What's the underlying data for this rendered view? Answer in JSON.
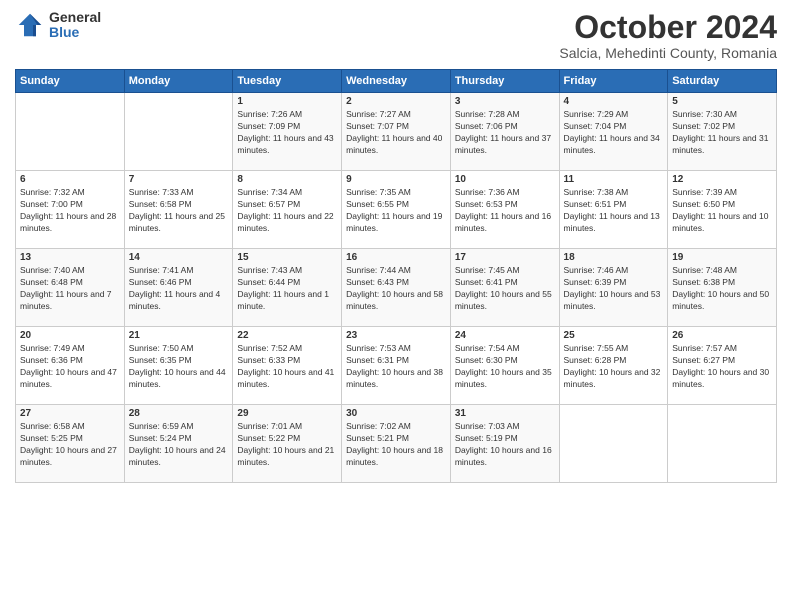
{
  "logo": {
    "general": "General",
    "blue": "Blue"
  },
  "header": {
    "month": "October 2024",
    "location": "Salcia, Mehedinti County, Romania"
  },
  "days_of_week": [
    "Sunday",
    "Monday",
    "Tuesday",
    "Wednesday",
    "Thursday",
    "Friday",
    "Saturday"
  ],
  "weeks": [
    [
      {
        "day": "",
        "info": ""
      },
      {
        "day": "",
        "info": ""
      },
      {
        "day": "1",
        "info": "Sunrise: 7:26 AM\nSunset: 7:09 PM\nDaylight: 11 hours and 43 minutes."
      },
      {
        "day": "2",
        "info": "Sunrise: 7:27 AM\nSunset: 7:07 PM\nDaylight: 11 hours and 40 minutes."
      },
      {
        "day": "3",
        "info": "Sunrise: 7:28 AM\nSunset: 7:06 PM\nDaylight: 11 hours and 37 minutes."
      },
      {
        "day": "4",
        "info": "Sunrise: 7:29 AM\nSunset: 7:04 PM\nDaylight: 11 hours and 34 minutes."
      },
      {
        "day": "5",
        "info": "Sunrise: 7:30 AM\nSunset: 7:02 PM\nDaylight: 11 hours and 31 minutes."
      }
    ],
    [
      {
        "day": "6",
        "info": "Sunrise: 7:32 AM\nSunset: 7:00 PM\nDaylight: 11 hours and 28 minutes."
      },
      {
        "day": "7",
        "info": "Sunrise: 7:33 AM\nSunset: 6:58 PM\nDaylight: 11 hours and 25 minutes."
      },
      {
        "day": "8",
        "info": "Sunrise: 7:34 AM\nSunset: 6:57 PM\nDaylight: 11 hours and 22 minutes."
      },
      {
        "day": "9",
        "info": "Sunrise: 7:35 AM\nSunset: 6:55 PM\nDaylight: 11 hours and 19 minutes."
      },
      {
        "day": "10",
        "info": "Sunrise: 7:36 AM\nSunset: 6:53 PM\nDaylight: 11 hours and 16 minutes."
      },
      {
        "day": "11",
        "info": "Sunrise: 7:38 AM\nSunset: 6:51 PM\nDaylight: 11 hours and 13 minutes."
      },
      {
        "day": "12",
        "info": "Sunrise: 7:39 AM\nSunset: 6:50 PM\nDaylight: 11 hours and 10 minutes."
      }
    ],
    [
      {
        "day": "13",
        "info": "Sunrise: 7:40 AM\nSunset: 6:48 PM\nDaylight: 11 hours and 7 minutes."
      },
      {
        "day": "14",
        "info": "Sunrise: 7:41 AM\nSunset: 6:46 PM\nDaylight: 11 hours and 4 minutes."
      },
      {
        "day": "15",
        "info": "Sunrise: 7:43 AM\nSunset: 6:44 PM\nDaylight: 11 hours and 1 minute."
      },
      {
        "day": "16",
        "info": "Sunrise: 7:44 AM\nSunset: 6:43 PM\nDaylight: 10 hours and 58 minutes."
      },
      {
        "day": "17",
        "info": "Sunrise: 7:45 AM\nSunset: 6:41 PM\nDaylight: 10 hours and 55 minutes."
      },
      {
        "day": "18",
        "info": "Sunrise: 7:46 AM\nSunset: 6:39 PM\nDaylight: 10 hours and 53 minutes."
      },
      {
        "day": "19",
        "info": "Sunrise: 7:48 AM\nSunset: 6:38 PM\nDaylight: 10 hours and 50 minutes."
      }
    ],
    [
      {
        "day": "20",
        "info": "Sunrise: 7:49 AM\nSunset: 6:36 PM\nDaylight: 10 hours and 47 minutes."
      },
      {
        "day": "21",
        "info": "Sunrise: 7:50 AM\nSunset: 6:35 PM\nDaylight: 10 hours and 44 minutes."
      },
      {
        "day": "22",
        "info": "Sunrise: 7:52 AM\nSunset: 6:33 PM\nDaylight: 10 hours and 41 minutes."
      },
      {
        "day": "23",
        "info": "Sunrise: 7:53 AM\nSunset: 6:31 PM\nDaylight: 10 hours and 38 minutes."
      },
      {
        "day": "24",
        "info": "Sunrise: 7:54 AM\nSunset: 6:30 PM\nDaylight: 10 hours and 35 minutes."
      },
      {
        "day": "25",
        "info": "Sunrise: 7:55 AM\nSunset: 6:28 PM\nDaylight: 10 hours and 32 minutes."
      },
      {
        "day": "26",
        "info": "Sunrise: 7:57 AM\nSunset: 6:27 PM\nDaylight: 10 hours and 30 minutes."
      }
    ],
    [
      {
        "day": "27",
        "info": "Sunrise: 6:58 AM\nSunset: 5:25 PM\nDaylight: 10 hours and 27 minutes."
      },
      {
        "day": "28",
        "info": "Sunrise: 6:59 AM\nSunset: 5:24 PM\nDaylight: 10 hours and 24 minutes."
      },
      {
        "day": "29",
        "info": "Sunrise: 7:01 AM\nSunset: 5:22 PM\nDaylight: 10 hours and 21 minutes."
      },
      {
        "day": "30",
        "info": "Sunrise: 7:02 AM\nSunset: 5:21 PM\nDaylight: 10 hours and 18 minutes."
      },
      {
        "day": "31",
        "info": "Sunrise: 7:03 AM\nSunset: 5:19 PM\nDaylight: 10 hours and 16 minutes."
      },
      {
        "day": "",
        "info": ""
      },
      {
        "day": "",
        "info": ""
      }
    ]
  ]
}
